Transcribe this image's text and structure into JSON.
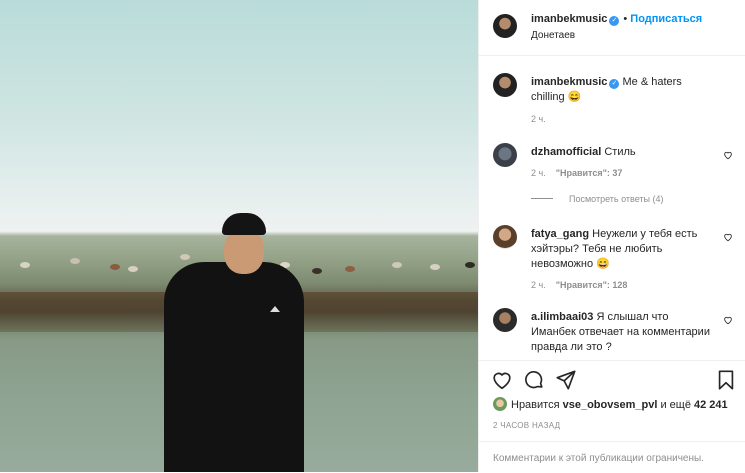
{
  "header": {
    "username": "imanbekmusic",
    "separator": "•",
    "follow_label": "Подписаться",
    "location": "Донетаев"
  },
  "caption": {
    "username": "imanbekmusic",
    "text": "Me & haters chilling 😄",
    "time": "2 ч."
  },
  "comments": [
    {
      "username": "dzhamofficial",
      "text": "Стиль",
      "time": "2 ч.",
      "likes": "\"Нравится\": 37",
      "replies": "Посмотреть ответы (4)"
    },
    {
      "username": "fatya_gang",
      "text": "Неужели у тебя есть хэйтэры? Тебя не любить невозможно 😄",
      "time": "2 ч.",
      "likes": "\"Нравится\": 128"
    },
    {
      "username": "a.ilimbaai03",
      "text": "Я слышал что Иманбек отвечает на комментарии правда ли это ?"
    }
  ],
  "actions": {
    "likes_prefix": "Нравится",
    "likes_user": "vse_obovsem_pvl",
    "likes_mid": "и ещё",
    "likes_count": "42 241",
    "posted_time": "2 ЧАСОВ НАЗАД",
    "comments_limited": "Комментарии к этой публикации ограничены."
  },
  "icons": {
    "verified": "verified-badge-icon",
    "like": "heart-icon",
    "comment": "comment-bubble-icon",
    "share": "paper-plane-icon",
    "save": "bookmark-icon"
  },
  "colors": {
    "link": "#0095f6",
    "verified": "#3897f0",
    "muted": "#8e8e8e",
    "text": "#262626"
  }
}
